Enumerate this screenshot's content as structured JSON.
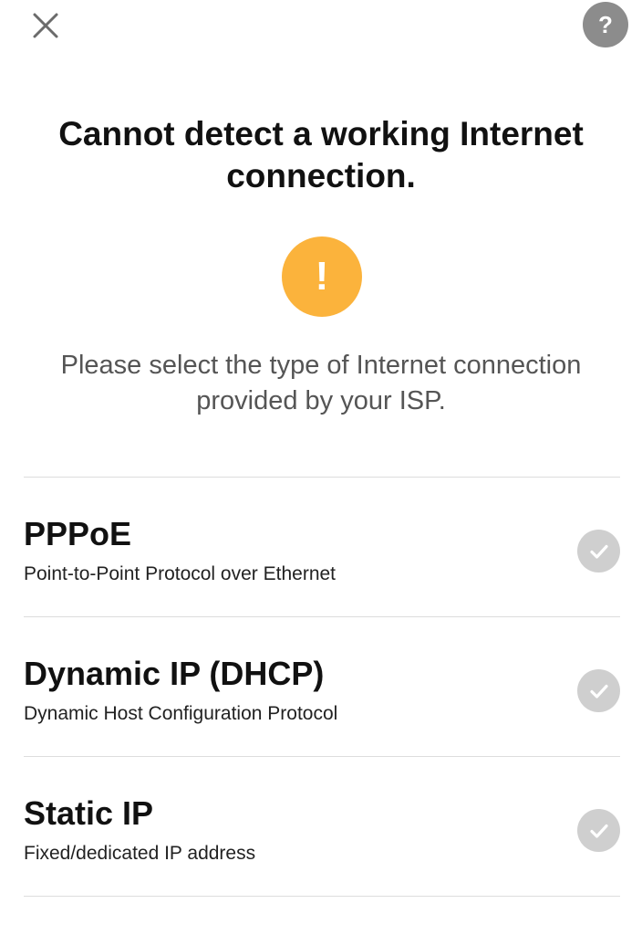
{
  "header": {
    "close_icon": "close-icon",
    "help_label": "?"
  },
  "title": "Cannot detect a working Internet connection.",
  "warning": {
    "symbol": "!",
    "icon": "exclamation-icon"
  },
  "subtitle": "Please select the type of Internet connection provided by your ISP.",
  "options": [
    {
      "name": "PPPoE",
      "description": "Point-to-Point Protocol over Ethernet",
      "icon": "check-circle-icon"
    },
    {
      "name": "Dynamic IP (DHCP)",
      "description": "Dynamic Host Configuration Protocol",
      "icon": "check-circle-icon"
    },
    {
      "name": "Static IP",
      "description": "Fixed/dedicated IP address",
      "icon": "check-circle-icon"
    }
  ],
  "colors": {
    "warning": "#fbb33c",
    "help_bg": "#8c8c8c",
    "check_bg": "#cfcfcf",
    "close_x": "#6b6b6b",
    "divider": "#dddddd"
  }
}
